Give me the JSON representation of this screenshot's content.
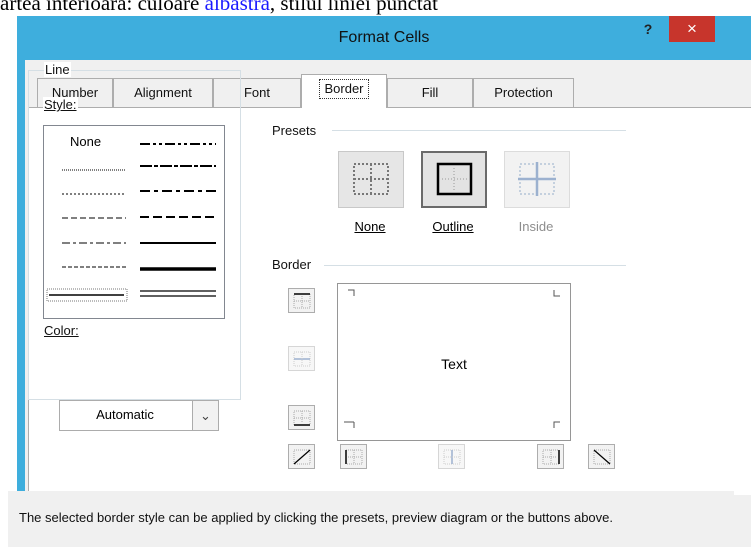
{
  "document": {
    "text_before": "artea interioară: culoare ",
    "link_text": "albastră",
    "text_after": ", stilul liniei punctat"
  },
  "dialog": {
    "title": "Format Cells",
    "help_label": "?",
    "close_label": "×",
    "tabs": [
      {
        "label": "Number",
        "active": false
      },
      {
        "label": "Alignment",
        "active": false
      },
      {
        "label": "Font",
        "active": false
      },
      {
        "label": "Border",
        "active": true
      },
      {
        "label": "Fill",
        "active": false
      },
      {
        "label": "Protection",
        "active": false
      }
    ]
  },
  "line": {
    "group_label": "Line",
    "style_label": "Style:",
    "style_none": "None",
    "color_label": "Color:",
    "color_value": "Automatic"
  },
  "presets": {
    "group_label": "Presets",
    "items": [
      {
        "label": "None",
        "enabled": true
      },
      {
        "label": "Outline",
        "enabled": true
      },
      {
        "label": "Inside",
        "enabled": false
      }
    ]
  },
  "border": {
    "group_label": "Border",
    "preview_text": "Text"
  },
  "hint": "The selected border style can be applied by clicking the presets, preview diagram or the buttons above.",
  "colors": {
    "titlebar": "#3eaedd",
    "close": "#c7352c",
    "link": "#1a1aff"
  }
}
